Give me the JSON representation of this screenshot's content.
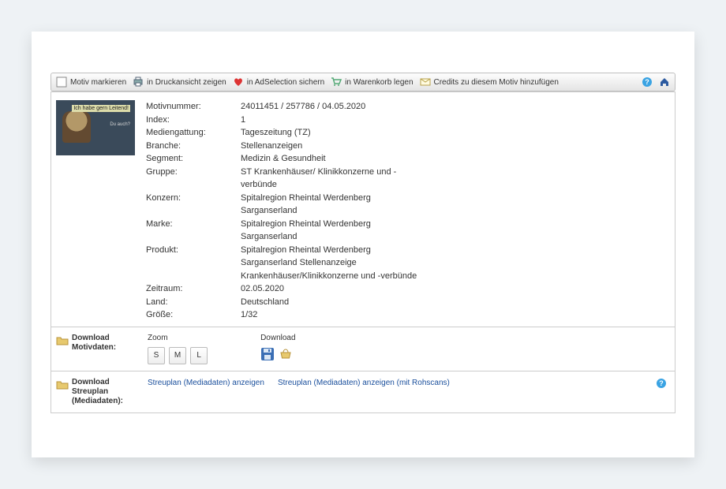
{
  "toolbar": {
    "mark": "Motiv markieren",
    "print": "in Druckansicht zeigen",
    "adselection": "in AdSelection sichern",
    "cart": "in Warenkorb legen",
    "credits": "Credits zu diesem Motiv hinzufügen"
  },
  "thumb": {
    "tag1": "Ich habe gern Leitend!",
    "tag2": "Du auch?"
  },
  "details": [
    {
      "k": "Motivnummer:",
      "v": "24011451 / 257786 / 04.05.2020"
    },
    {
      "k": "Index:",
      "v": "1"
    },
    {
      "k": "Mediengattung:",
      "v": "Tageszeitung (TZ)"
    },
    {
      "k": "Branche:",
      "v": "Stellenanzeigen"
    },
    {
      "k": "Segment:",
      "v": "Medizin & Gesundheit"
    },
    {
      "k": "Gruppe:",
      "v": "ST Krankenhäuser/ Klinikkonzerne und -verbünde"
    },
    {
      "k": "Konzern:",
      "v": "Spitalregion Rheintal Werdenberg Sarganserland"
    },
    {
      "k": "Marke:",
      "v": "Spitalregion Rheintal Werdenberg Sarganserland"
    },
    {
      "k": "Produkt:",
      "v": "Spitalregion Rheintal Werdenberg Sarganserland Stellenanzeige Krankenhäuser/Klinikkonzerne und -verbünde"
    },
    {
      "k": "Zeitraum:",
      "v": "02.05.2020"
    },
    {
      "k": "Land:",
      "v": "Deutschland"
    },
    {
      "k": "Größe:",
      "v": "1/32"
    }
  ],
  "motivdaten": {
    "section_label": "Download Motivdaten:",
    "zoom_label": "Zoom",
    "download_label": "Download",
    "zoom_s": "S",
    "zoom_m": "M",
    "zoom_l": "L"
  },
  "streuplan": {
    "section_label": "Download Streuplan (Mediadaten):",
    "link1": "Streuplan (Mediadaten) anzeigen",
    "link2": "Streuplan (Mediadaten) anzeigen (mit Rohscans)"
  }
}
